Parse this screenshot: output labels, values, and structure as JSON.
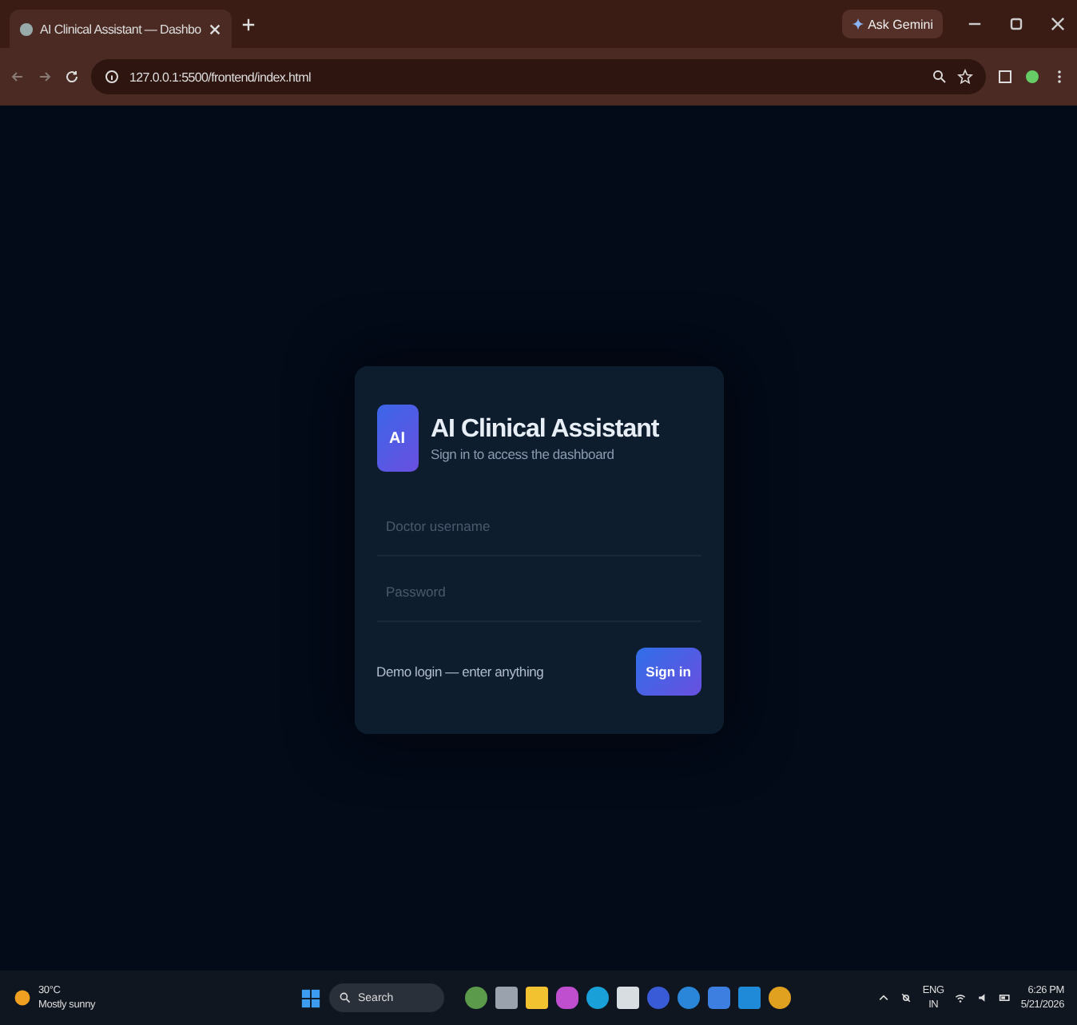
{
  "browser": {
    "tab_title": "AI Clinical Assistant — Dashbo",
    "ask_button": "Ask Gemini",
    "url": "127.0.0.1:5500/frontend/index.html"
  },
  "login": {
    "logo": "AI",
    "title": "AI Clinical Assistant",
    "subtitle": "Sign in to access the dashboard",
    "fields": [
      {
        "placeholder": "Doctor username"
      },
      {
        "placeholder": "Password"
      }
    ],
    "hint": "Demo login — enter anything",
    "button": "Sign in"
  },
  "taskbar": {
    "weather_temp": "30°C",
    "weather_text": "Mostly sunny",
    "search": "Search",
    "lang": "ENG",
    "region": "IN",
    "time": "6:26 PM",
    "date": "5/21/2026"
  }
}
